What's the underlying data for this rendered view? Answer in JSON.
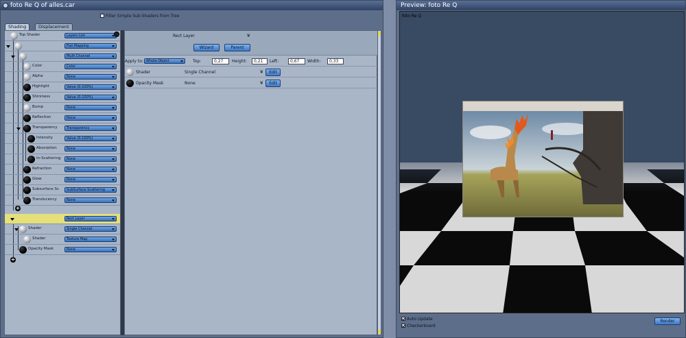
{
  "editor": {
    "title": "foto Re Q of alles.car",
    "filter_label": "Filter Simple Sub-Shaders from Tree",
    "tabs": [
      "Shading",
      "Displacement"
    ],
    "tree": [
      {
        "label": "Top Shader",
        "value": "Layers List"
      },
      {
        "label": "",
        "value": "Flat Mapping"
      },
      {
        "label": "",
        "value": "Multi Channel"
      },
      {
        "label": "Color",
        "value": "Color"
      },
      {
        "label": "Alpha",
        "value": "None"
      },
      {
        "label": "Highlight",
        "value": "Value (0-100%)"
      },
      {
        "label": "Shininess",
        "value": "Value (0-100%)"
      },
      {
        "label": "Bump",
        "value": "None"
      },
      {
        "label": "Reflection",
        "value": "None"
      },
      {
        "label": "Transparency",
        "value": "Transparency"
      },
      {
        "label": "Intensity",
        "value": "Value (0-100%)"
      },
      {
        "label": "Absorption",
        "value": "None"
      },
      {
        "label": "In-Scattering",
        "value": "None"
      },
      {
        "label": "Refraction",
        "value": "None"
      },
      {
        "label": "Glow",
        "value": "None"
      },
      {
        "label": "Subsurface Sc",
        "value": "SubSurface Scattering"
      },
      {
        "label": "Translucency",
        "value": "None"
      },
      {
        "label": "",
        "value": "Rect Layer"
      },
      {
        "label": "Shader",
        "value": "Single Channel"
      },
      {
        "label": "Shader",
        "value": "Texture Map"
      },
      {
        "label": "Opacity Mask",
        "value": "None"
      }
    ],
    "props": {
      "layer_title": "Rect Layer",
      "wizard": "Wizard",
      "parent": "Parent",
      "apply_to_label": "Apply to:",
      "apply_to_value": "Whole Object",
      "top_label": "Top:",
      "top_value": "0,27",
      "height_label": "Height:",
      "height_value": "0,21",
      "left_label": "Left:",
      "left_value": "0,67",
      "width_label": "Width:",
      "width_value": "0,33",
      "rows": [
        {
          "label": "Shader",
          "value": "Single Channel",
          "edit": "Edit"
        },
        {
          "label": "Opacity Mask",
          "value": "None",
          "edit": "Edit"
        }
      ]
    }
  },
  "preview": {
    "title": "Preview: foto Re Q",
    "view_label": "foto Re Q",
    "auto_update": "Auto Update",
    "checkerboard": "Checkerboard",
    "render": "Render"
  }
}
